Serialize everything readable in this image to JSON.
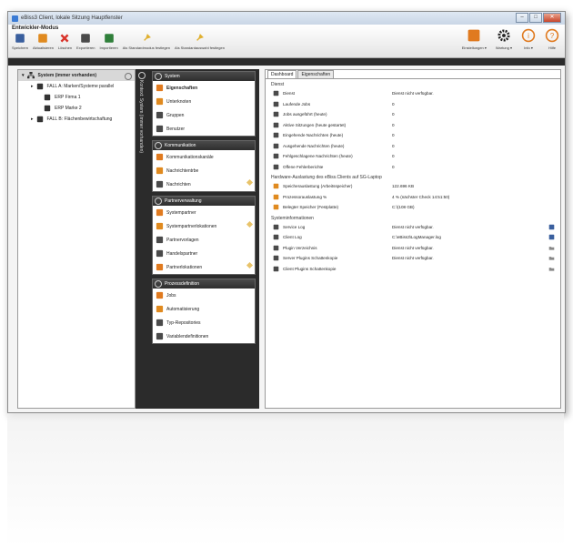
{
  "window": {
    "title": "eBiss3 Client, lokale Sitzung Hauptfenster",
    "mode_label": "Entwickler-Modus"
  },
  "toolbar": {
    "items": [
      {
        "label": "Speichern",
        "icon": "save-icon"
      },
      {
        "label": "Aktualisieren",
        "icon": "refresh-icon"
      },
      {
        "label": "Löschen",
        "icon": "delete-icon"
      },
      {
        "label": "Exportieren",
        "icon": "export-icon"
      },
      {
        "label": "Importieren",
        "icon": "import-icon"
      },
      {
        "label": "Als Standardmodus festlegen",
        "icon": "pin-icon"
      },
      {
        "label": "Als Standardauswahl festlegen",
        "icon": "pin-icon"
      }
    ],
    "right_items": [
      {
        "label": "Einstellungen ▾",
        "icon": "settings-window-icon"
      },
      {
        "label": "Wartung ▾",
        "icon": "gear-icon"
      },
      {
        "label": "Info ▾",
        "icon": "info-bubble-icon"
      },
      {
        "label": "Hilfe",
        "icon": "help-icon"
      }
    ]
  },
  "tree": {
    "root": "System (immer vorhanden)",
    "items": [
      {
        "label": "FALL A: Marken/Systeme parallel",
        "level": 1
      },
      {
        "label": "ERP Firma 1",
        "level": 2
      },
      {
        "label": "ERP Marke 2",
        "level": 2
      },
      {
        "label": "FALL B: Flächenbewirtschaftung",
        "level": 1
      }
    ]
  },
  "vertical_tab": "Kontext: System (immer vorhanden)",
  "groups": [
    {
      "title": "System",
      "items": [
        {
          "label": "Eigenschaften",
          "selected": true
        },
        {
          "label": "Unterknoten"
        },
        {
          "label": "Gruppen"
        },
        {
          "label": "Benutzer"
        }
      ]
    },
    {
      "title": "Kommunikation",
      "items": [
        {
          "label": "Kommunikationskanäle"
        },
        {
          "label": "Nachrichtentrbe"
        },
        {
          "label": "Nachrichten",
          "edit": true
        }
      ]
    },
    {
      "title": "Partnerverwaltung",
      "items": [
        {
          "label": "Systempartner"
        },
        {
          "label": "Systempartnerlokationen",
          "edit": true
        },
        {
          "label": "Partnervorlagen"
        },
        {
          "label": "Handelspartner"
        },
        {
          "label": "Partnerlokationen",
          "edit": true
        }
      ]
    },
    {
      "title": "Prozessdefinition",
      "items": [
        {
          "label": "Jobs"
        },
        {
          "label": "Automatisierung"
        },
        {
          "label": "Typ-Repositories"
        },
        {
          "label": "Variablendefinitionen"
        }
      ]
    }
  ],
  "tabs": [
    "Dashboard",
    "Eigenschaften"
  ],
  "dashboard": {
    "section_dienst": "Dienst",
    "dienst_rows": [
      {
        "label": "Dienst",
        "value": "Dienst nicht verfügbar."
      },
      {
        "label": "Laufende Jobs",
        "value": "0"
      },
      {
        "label": "Jobs ausgeführt (heute)",
        "value": "0"
      },
      {
        "label": "Aktive Sitzungen (heute gestartet)",
        "value": "0"
      },
      {
        "label": "Eingehende Nachrichten (heute)",
        "value": "0"
      },
      {
        "label": "Ausgehende Nachrichten (heute)",
        "value": "0"
      },
      {
        "label": "Fehlgeschlagene Nachrichten (heute)",
        "value": "0"
      },
      {
        "label": "Offene Fehlerberichte",
        "value": "0"
      }
    ],
    "section_hardware": "Hardware-Auslastung des eBiss.Clients auf SG-Laptop",
    "hardware_rows": [
      {
        "label": "Speicherauslastung (Arbeitsspeicher)",
        "value": "122.696 KB"
      },
      {
        "label": "Prozessorauslastung %",
        "value": "4 % (nächster Check 14:51:50)"
      },
      {
        "label": "Belegter Speicher (Festplatte)",
        "value": "C:\\(108 GB)"
      }
    ],
    "section_system": "Systeminformationen",
    "system_rows": [
      {
        "label": "Service Log",
        "value": "Dienst nicht verfügbar.",
        "action": "save-icon"
      },
      {
        "label": "Client Log",
        "value": "C:\\eBiss3\\LogManager.log",
        "action": "save-icon"
      },
      {
        "label": "Plugin Verzeichnis",
        "value": "Dienst nicht verfügbar.",
        "action": "folder-icon"
      },
      {
        "label": "Server Plugins Schattenkopie",
        "value": "Dienst nicht verfügbar.",
        "action": "folder-icon"
      },
      {
        "label": "Client Plugins Schattenkopie",
        "value": "",
        "action": "folder-icon"
      }
    ]
  },
  "colors": {
    "dark_panel": "#2b2b2b",
    "accent_orange": "#e07a1f",
    "selection_grey": "#d8d8d8"
  }
}
